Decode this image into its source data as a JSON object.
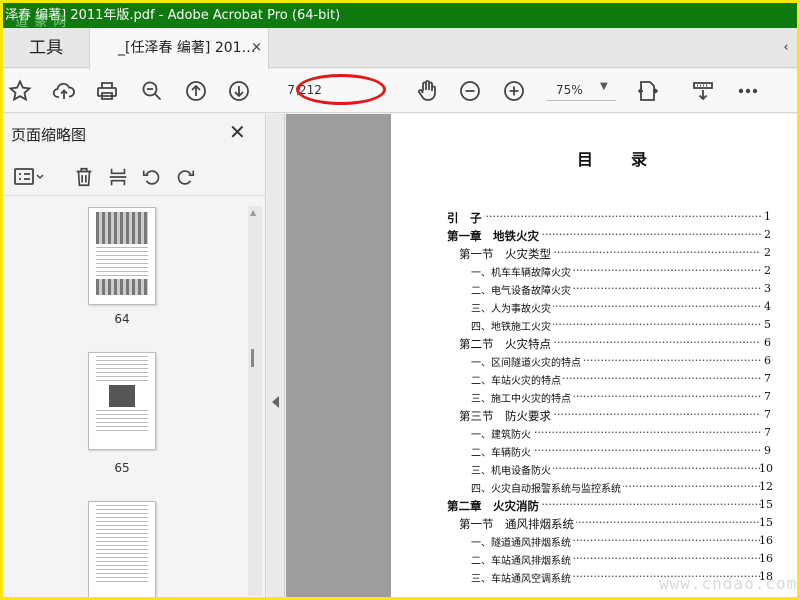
{
  "window": {
    "title": "泽春 编著] 2011年版.pdf - Adobe Acrobat Pro (64-bit)",
    "watermark": "道 篆 网"
  },
  "tabs": {
    "tools_label": "工具",
    "doc_label": "_[任泽春 编著] 201…",
    "close": "×",
    "scroll": "‹"
  },
  "toolbar": {
    "icons": [
      "star-icon",
      "cloud-upload-icon",
      "print-icon",
      "zoom-out-search-icon",
      "page-up-icon",
      "page-down-icon",
      "hand-icon",
      "zoom-out-icon",
      "zoom-in-icon",
      "fit-page-icon",
      "scroll-mode-icon",
      "more-icon"
    ],
    "page_current": "7",
    "page_separator": "/",
    "page_total": "212",
    "zoom": "75%"
  },
  "sidebar": {
    "title": "页面缩略图",
    "close": "✕",
    "thumbnails": [
      {
        "label": "64"
      },
      {
        "label": "65"
      },
      {
        "label": ""
      }
    ]
  },
  "document": {
    "toc_title": "目　　录",
    "entries": [
      {
        "level": 0,
        "text": "引　子",
        "page": "1"
      },
      {
        "level": 0,
        "text": "第一章　地铁火灾",
        "page": "2"
      },
      {
        "level": 1,
        "text": "第一节　火灾类型",
        "page": "2"
      },
      {
        "level": 2,
        "text": "一、机车车辆故障火灾",
        "page": "2"
      },
      {
        "level": 2,
        "text": "二、电气设备故障火灾",
        "page": "3"
      },
      {
        "level": 2,
        "text": "三、人为事故火灾",
        "page": "4"
      },
      {
        "level": 2,
        "text": "四、地铁施工火灾",
        "page": "5"
      },
      {
        "level": 1,
        "text": "第二节　火灾特点",
        "page": "6"
      },
      {
        "level": 2,
        "text": "一、区间隧道火灾的特点",
        "page": "6"
      },
      {
        "level": 2,
        "text": "二、车站火灾的特点",
        "page": "7"
      },
      {
        "level": 2,
        "text": "三、施工中火灾的特点",
        "page": "7"
      },
      {
        "level": 1,
        "text": "第三节　防火要求",
        "page": "7"
      },
      {
        "level": 2,
        "text": "一、建筑防火",
        "page": "7"
      },
      {
        "level": 2,
        "text": "二、车辆防火",
        "page": "9"
      },
      {
        "level": 2,
        "text": "三、机电设备防火",
        "page": "10"
      },
      {
        "level": 2,
        "text": "四、火灾自动报警系统与监控系统",
        "page": "12"
      },
      {
        "level": 0,
        "text": "第二章　火灾消防",
        "page": "15"
      },
      {
        "level": 1,
        "text": "第一节　通风排烟系统",
        "page": "15"
      },
      {
        "level": 2,
        "text": "一、隧道通风排烟系统",
        "page": "16"
      },
      {
        "level": 2,
        "text": "二、车站通风排烟系统",
        "page": "16"
      },
      {
        "level": 2,
        "text": "三、车站通风空调系统",
        "page": "18"
      }
    ],
    "watermark": "www.cndao.com"
  },
  "colors": {
    "titlebar": "#0f7a0f",
    "annotation_red": "#e01818",
    "frame_yellow": "#ffe700"
  }
}
